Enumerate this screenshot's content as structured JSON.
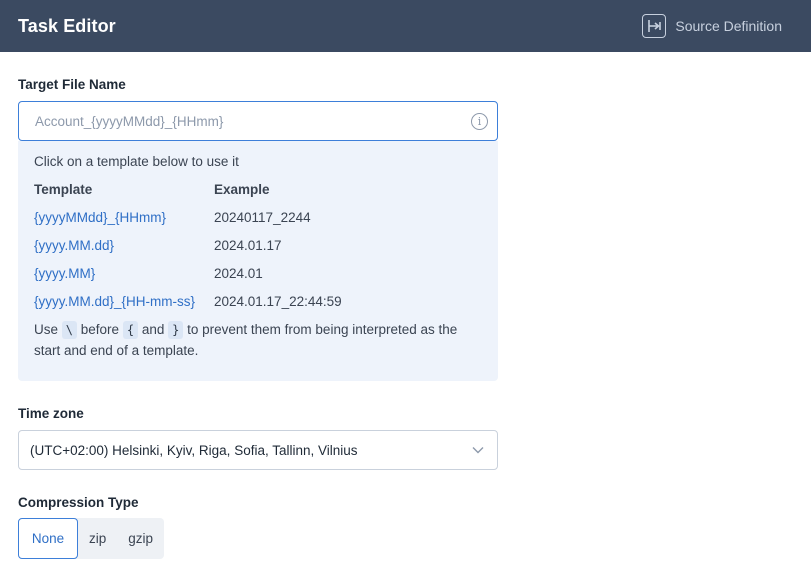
{
  "header": {
    "title": "Task Editor",
    "source_definition_label": "Source Definition",
    "source_definition_icon": "arrow-into-bracket-icon"
  },
  "target_file": {
    "label": "Target File Name",
    "placeholder": "Account_{yyyyMMdd}_{HHmm}",
    "value": "",
    "info_icon": "info-icon"
  },
  "templates": {
    "hint": "Click on a template below to use it",
    "col_template": "Template",
    "col_example": "Example",
    "rows": [
      {
        "template": "{yyyyMMdd}_{HHmm}",
        "example": "20240117_2244"
      },
      {
        "template": "{yyyy.MM.dd}",
        "example": "2024.01.17"
      },
      {
        "template": "{yyyy.MM}",
        "example": "2024.01"
      },
      {
        "template": "{yyyy.MM.dd}_{HH-mm-ss}",
        "example": "2024.01.17_22:44:59"
      }
    ],
    "escape_note": {
      "use": "Use",
      "backslash": "\\",
      "before": "before",
      "open_brace": "{",
      "and": "and",
      "close_brace": "}",
      "rest": "to prevent them from being interpreted as the start and end of a template."
    }
  },
  "time_zone": {
    "label": "Time zone",
    "value": "(UTC+02:00) Helsinki, Kyiv, Riga, Sofia, Tallinn, Vilnius",
    "chevron_icon": "chevron-down-icon"
  },
  "compression": {
    "label": "Compression Type",
    "options": [
      "None",
      "zip",
      "gzip"
    ],
    "selected": "None"
  },
  "colors": {
    "header_bg": "#3b4a61",
    "accent": "#3d7fd9",
    "link": "#2f6fc6",
    "panel_bg": "#eef3fb"
  }
}
